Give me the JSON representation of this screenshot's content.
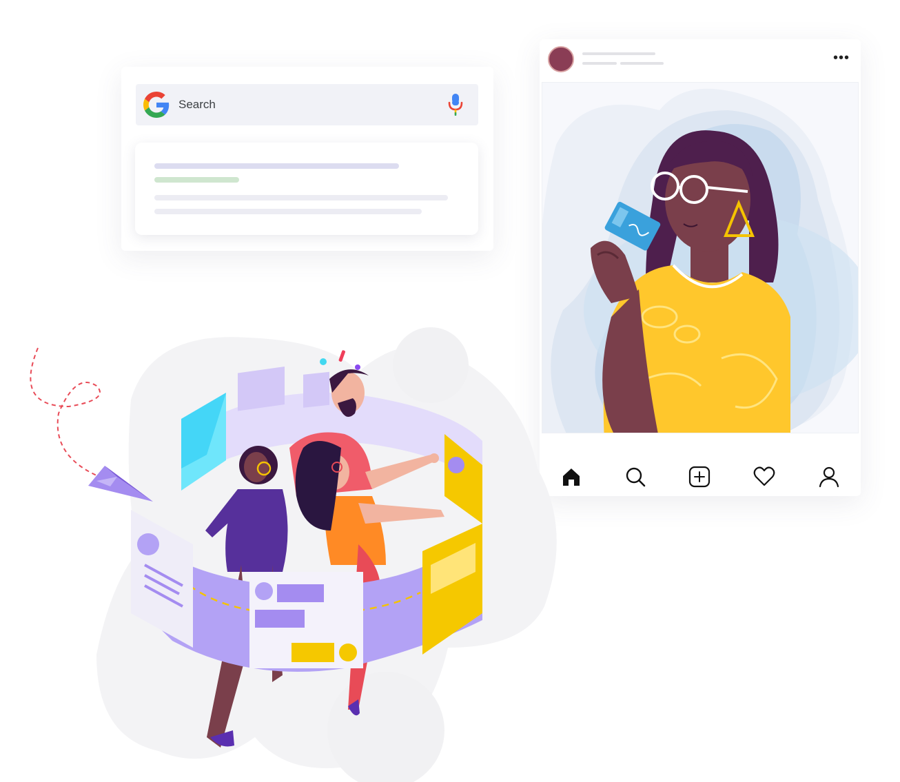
{
  "search": {
    "placeholder": "Search"
  },
  "post": {
    "more_icon": "more-horizontal-icon",
    "nav": [
      {
        "name": "home",
        "icon": "home-icon"
      },
      {
        "name": "search",
        "icon": "search-icon"
      },
      {
        "name": "add",
        "icon": "add-square-icon"
      },
      {
        "name": "likes",
        "icon": "heart-icon"
      },
      {
        "name": "profile",
        "icon": "user-icon"
      }
    ]
  },
  "colors": {
    "google_blue": "#4285F4",
    "google_red": "#EA4335",
    "google_yellow": "#FBBC05",
    "google_green": "#34A853",
    "accent_purple": "#a48cf0",
    "accent_yellow": "#f5c800",
    "avatar": "#8a3d55"
  }
}
